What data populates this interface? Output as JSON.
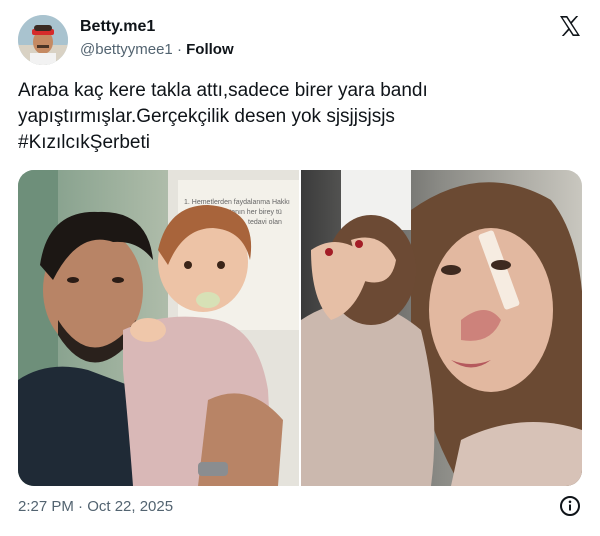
{
  "author": {
    "display_name": "Betty.me1",
    "handle": "@bettyymee1",
    "separator": "·",
    "follow_label": "Follow"
  },
  "tweet": {
    "text_line1": "Araba kaç kere takla attı,sadece birer yara bandı",
    "text_line2": "yapıştırmışlar.Gerçekçilik desen yok sjsjjsjsjs",
    "hashtag": "#KızılcıkŞerbeti"
  },
  "media": {
    "left_photo": "photo-man-holding-baby",
    "right_photo": "photo-woman-embracing-baby",
    "poster_line1": "1. Hemetlerden faydalanma Hakkı",
    "poster_line2": "hastanın her birey tü",
    "poster_line3": "tedavi olan"
  },
  "footer": {
    "timestamp": "2:27 PM · Oct 22, 2025"
  },
  "icons": {
    "platform": "x-logo-icon",
    "info": "info-icon"
  },
  "colors": {
    "text": "#0f1419",
    "secondary": "#536471"
  }
}
